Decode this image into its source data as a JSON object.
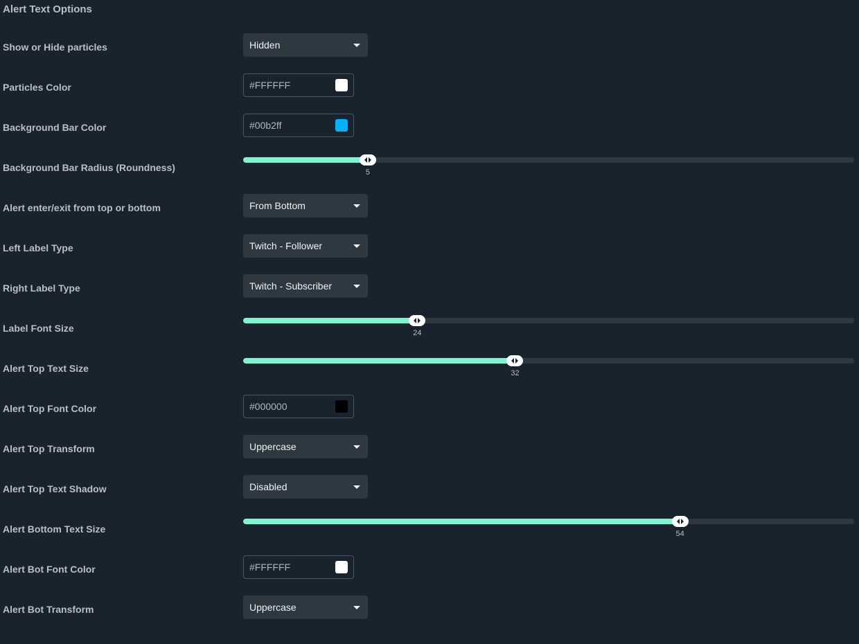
{
  "title": "Alert Text Options",
  "rows": [
    {
      "label": "Show or Hide particles",
      "type": "select",
      "value": "Hidden"
    },
    {
      "label": "Particles Color",
      "type": "color",
      "value": "#FFFFFF",
      "swatch": "#ffffff"
    },
    {
      "label": "Background Bar Color",
      "type": "color",
      "value": "#00b2ff",
      "swatch": "#00b2ff"
    },
    {
      "label": "Background Bar Radius (Roundness)",
      "type": "slider",
      "value": "5",
      "fraction": 0.204
    },
    {
      "label": "Alert enter/exit from top or bottom",
      "type": "select",
      "value": "From Bottom"
    },
    {
      "label": "Left Label Type",
      "type": "select",
      "value": "Twitch - Follower"
    },
    {
      "label": "Right Label Type",
      "type": "select",
      "value": "Twitch - Subscriber"
    },
    {
      "label": "Label Font Size",
      "type": "slider",
      "value": "24",
      "fraction": 0.285
    },
    {
      "label": "Alert Top Text Size",
      "type": "slider",
      "value": "32",
      "fraction": 0.445
    },
    {
      "label": "Alert Top Font Color",
      "type": "color",
      "value": "#000000",
      "swatch": "#000000"
    },
    {
      "label": "Alert Top Transform",
      "type": "select",
      "value": "Uppercase"
    },
    {
      "label": "Alert Top Text Shadow",
      "type": "select",
      "value": "Disabled"
    },
    {
      "label": "Alert Bottom Text Size",
      "type": "slider",
      "value": "54",
      "fraction": 0.715
    },
    {
      "label": "Alert Bot Font Color",
      "type": "color",
      "value": "#FFFFFF",
      "swatch": "#ffffff"
    },
    {
      "label": "Alert Bot Transform",
      "type": "select",
      "value": "Uppercase"
    }
  ],
  "colors": {
    "accent": "#7ef5d0",
    "background": "#19232d",
    "control": "#2d3841"
  }
}
